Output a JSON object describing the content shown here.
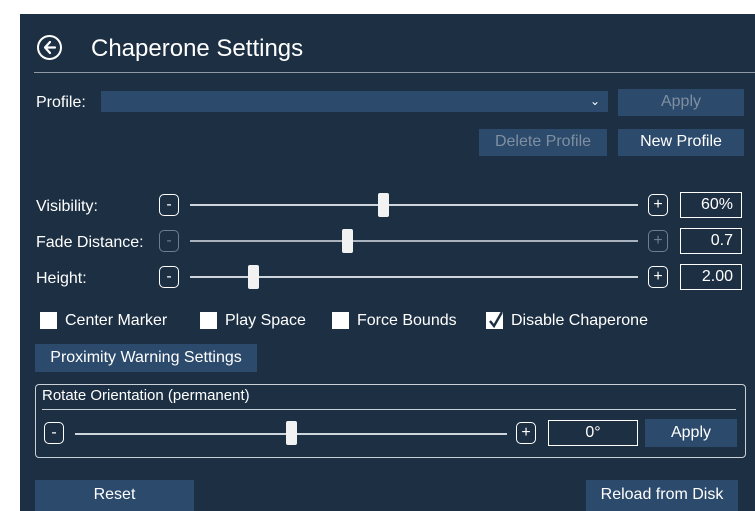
{
  "header": {
    "title": "Chaperone Settings"
  },
  "profile": {
    "label": "Profile:",
    "selected": "",
    "apply_label": "Apply",
    "delete_label": "Delete Profile",
    "new_label": "New Profile"
  },
  "sliders": [
    {
      "label": "Visibility:",
      "value": "60%",
      "minus": "-",
      "plus": "+",
      "position": 0.43,
      "enabled": true
    },
    {
      "label": "Fade Distance:",
      "value": "0.7",
      "minus": "-",
      "plus": "+",
      "position": 0.35,
      "enabled": false
    },
    {
      "label": "Height:",
      "value": "2.00",
      "minus": "-",
      "plus": "+",
      "position": 0.14,
      "enabled": true
    }
  ],
  "checkboxes": [
    {
      "label": "Center Marker",
      "checked": false
    },
    {
      "label": "Play Space",
      "checked": false
    },
    {
      "label": "Force Bounds",
      "checked": false
    },
    {
      "label": "Disable Chaperone",
      "checked": true
    }
  ],
  "proximity_button": "Proximity Warning Settings",
  "rotate": {
    "title": "Rotate Orientation (permanent)",
    "minus": "-",
    "plus": "+",
    "value": "0°",
    "position": 0.5,
    "apply_label": "Apply"
  },
  "footer": {
    "reset_label": "Reset",
    "reload_label": "Reload from Disk"
  },
  "colors": {
    "background": "#1d2f43",
    "button": "#2c4a6b",
    "disabled_text": "#7f8fa1"
  }
}
